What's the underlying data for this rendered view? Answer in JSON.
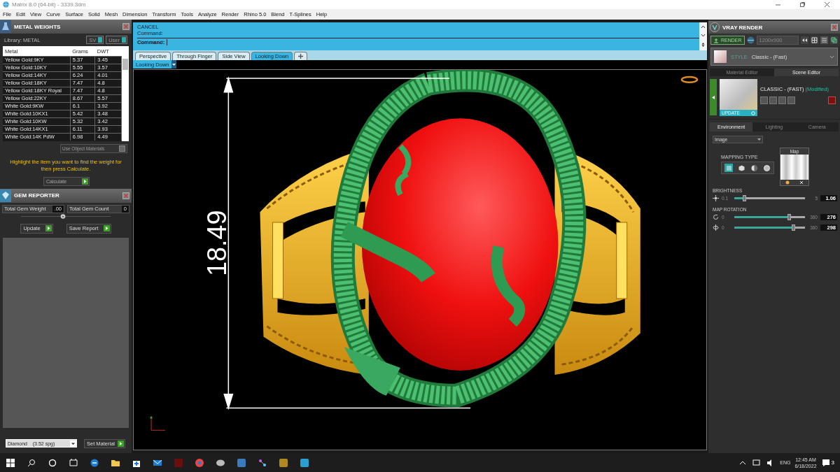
{
  "window": {
    "title": "Matrix 8.0 (64-bit) - 3339.3dm"
  },
  "menu": [
    "File",
    "Edit",
    "View",
    "Curve",
    "Surface",
    "Solid",
    "Mesh",
    "Dimension",
    "Transform",
    "Tools",
    "Analyze",
    "Render",
    "Rhino 5.0",
    "Blend",
    "T-Splines",
    "Help"
  ],
  "metal_weights": {
    "title": "METAL WEIGHTS",
    "library": "Library: METAL",
    "toggles": [
      "SV",
      "User"
    ],
    "columns": [
      "Metal",
      "Grams",
      "DWT"
    ],
    "rows": [
      [
        "Yellow Gold:9KY",
        "5.37",
        "3.45"
      ],
      [
        "Yellow Gold:10KY",
        "5.55",
        "3.57"
      ],
      [
        "Yellow Gold:14KY",
        "6.24",
        "4.01"
      ],
      [
        "Yellow Gold:18KY",
        "7.47",
        "4.8"
      ],
      [
        "Yellow Gold:18KY Royal",
        "7.47",
        "4.8"
      ],
      [
        "Yellow Gold:22KY",
        "8.67",
        "5.57"
      ],
      [
        "White Gold:9KW",
        "6.1",
        "3.92"
      ],
      [
        "White Gold:10KX1",
        "5.42",
        "3.48"
      ],
      [
        "White Gold:10KW",
        "5.32",
        "3.42"
      ],
      [
        "White Gold:14KX1",
        "6.11",
        "3.93"
      ],
      [
        "White Gold:14K PdW",
        "6.98",
        "4.49"
      ]
    ],
    "use_object_materials": {
      "label": "Use Object Materials",
      "checked": false
    },
    "hint": "Highlight the item you want to find the weight for then press Calculate.",
    "calculate": "Calculate"
  },
  "gem_reporter": {
    "title": "GEM REPORTER",
    "total_weight_label": "Total Gem Weight",
    "total_weight": ".00",
    "total_count_label": "Total Gem Count",
    "total_count": "0",
    "buttons": [
      "Update",
      "Save Report"
    ],
    "material": "Diamond    (3.52 spg)",
    "set_material": "Set Material"
  },
  "command": {
    "lines": [
      "CANCEL",
      "Command:"
    ],
    "prompt": "Command:"
  },
  "viewport": {
    "tabs": [
      {
        "label": "Perspective",
        "selected": false
      },
      {
        "label": "Through Finger",
        "selected": false
      },
      {
        "label": "Side View",
        "selected": false
      },
      {
        "label": "Looking Down",
        "selected": true
      }
    ],
    "view_menu": "Looking Down",
    "dimension": "18.49"
  },
  "vray": {
    "title": "VRAY RENDER",
    "render": "RENDER",
    "resolution": "1200x900",
    "style_label": "STYLE",
    "style": "Classic - (Fast)",
    "editor_tabs": [
      {
        "label": "Material Editor",
        "selected": false
      },
      {
        "label": "Scene Editor",
        "selected": true
      }
    ],
    "preset": "CLASSIC - (FAST)",
    "preset_status": "(Modified)",
    "update": "UPDATE",
    "scene_tabs": [
      {
        "label": "Environment",
        "selected": true
      },
      {
        "label": "Lighting",
        "selected": false
      },
      {
        "label": "Camera",
        "selected": false
      }
    ],
    "environment": "Image",
    "mapping_type_label": "MAPPING TYPE",
    "mapping_types": [
      {
        "kind": "plane",
        "selected": true
      },
      {
        "kind": "cube",
        "selected": false
      },
      {
        "kind": "sphere",
        "selected": false
      },
      {
        "kind": "dome",
        "selected": false
      }
    ],
    "map_label": "Map",
    "sections": [
      {
        "label": "BRIGHTNESS",
        "sliders": [
          {
            "kind": "sun",
            "min": "0.1",
            "max": "5",
            "value": "1.06",
            "level": 0.14
          }
        ]
      },
      {
        "label": "MAP ROTATION",
        "sliders": [
          {
            "kind": "rotate",
            "min": "0",
            "max": "360",
            "value": "276",
            "level": 0.77
          },
          {
            "kind": "tilt",
            "min": "0",
            "max": "360",
            "value": "298",
            "level": 0.83
          }
        ]
      }
    ]
  },
  "taskbar": {
    "language": "ENG",
    "time": "12:45 AM",
    "date": "6/18/2022",
    "notifications": "3"
  }
}
